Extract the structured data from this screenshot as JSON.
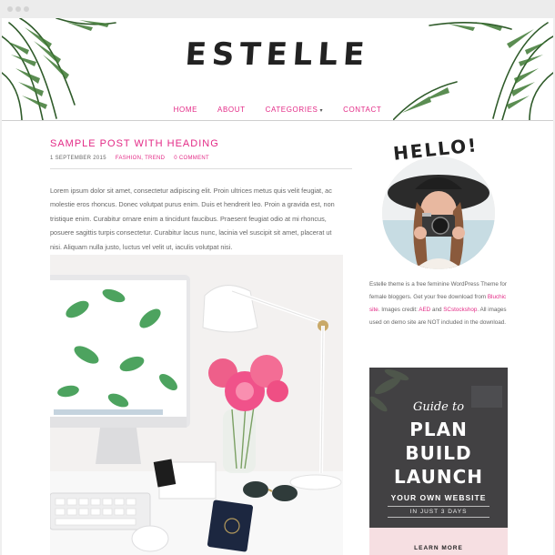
{
  "site": {
    "logo": "ESTELLE"
  },
  "nav": [
    {
      "label": "HOME"
    },
    {
      "label": "ABOUT"
    },
    {
      "label": "CATEGORIES"
    },
    {
      "label": "CONTACT"
    }
  ],
  "post": {
    "title": "SAMPLE POST WITH HEADING",
    "date": "1 SEPTEMBER 2015",
    "categories": "FASHION, TREND",
    "comments": "0 COMMENT",
    "excerpt": "Lorem ipsum dolor sit amet, consectetur adipiscing elit. Proin ultrices metus quis velit feugiat, ac molestie eros rhoncus. Donec volutpat purus enim. Duis et hendrerit leo. Proin a gravida est, non tristique enim. Curabitur ornare enim a tincidunt faucibus. Praesent feugiat odio at mi rhoncus, posuere sagittis turpis consectetur. Curabitur lacus nunc, lacinia vel suscipit sit amet, placerat ut nisi. Aliquam nulla justo, luctus vel velit ut, iaculis volutpat nisi."
  },
  "sidebar": {
    "hello": "HELLO!",
    "text_1": "Estelle theme is a free feminine WordPress Theme for female bloggers. Get your free download from ",
    "link_1": "Bluchic site",
    "text_2": ". Images credit: ",
    "link_2": "AED",
    "text_3": " and ",
    "link_3": "SCstockshop",
    "text_4": ". All images used on demo site are NOT included in the download."
  },
  "ad": {
    "guide": "Guide to",
    "line1": "PLAN",
    "line2": "BUILD",
    "line3": "LAUNCH",
    "sub": "YOUR OWN WEBSITE",
    "days": "IN JUST 3 DAYS",
    "button": "LEARN MORE"
  },
  "colors": {
    "accent": "#e32a86",
    "text": "#666666",
    "dark": "#222222"
  }
}
